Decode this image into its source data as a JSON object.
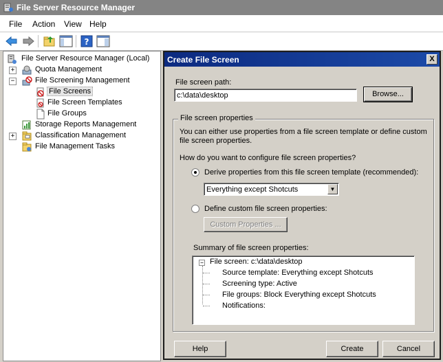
{
  "window": {
    "title": "File Server Resource Manager"
  },
  "menu": [
    "File",
    "Action",
    "View",
    "Help"
  ],
  "toolbar": {
    "icons": [
      "back-arrow-icon",
      "forward-arrow-icon",
      "up-folder-icon",
      "show-hide-tree-icon",
      "help-icon",
      "action-pane-icon"
    ]
  },
  "tree": {
    "root": "File Server Resource Manager (Local)",
    "items": [
      {
        "label": "Quota Management",
        "expander": "+"
      },
      {
        "label": "File Screening Management",
        "expander": "−"
      },
      {
        "label": "File Screens"
      },
      {
        "label": "File Screen Templates"
      },
      {
        "label": "File Groups"
      },
      {
        "label": "Storage Reports Management"
      },
      {
        "label": "Classification Management",
        "expander": "+"
      },
      {
        "label": "File Management Tasks"
      }
    ]
  },
  "dialog": {
    "title": "Create File Screen",
    "close": "X",
    "path_label": "File screen path:",
    "path_value": "c:\\data\\desktop",
    "browse": "Browse...",
    "group_title": "File screen properties",
    "desc_line1": "You can either use properties from a file screen template or define custom",
    "desc_line2": "file screen properties.",
    "question": "How do you want to configure file screen properties?",
    "radio_derive": "Derive properties from this file screen template (recommended):",
    "template_value": "Everything except Shotcuts",
    "radio_custom": "Define custom file screen properties:",
    "custom_button": "Custom Properties ...",
    "summary_label": "Summary of file screen properties:",
    "summary": {
      "root": "File screen: c:\\data\\desktop",
      "lines": [
        "Source template: Everything except Shotcuts",
        "Screening type: Active",
        "File groups: Block Everything except Shotcuts",
        "Notifications:"
      ]
    },
    "help": "Help",
    "create": "Create",
    "cancel": "Cancel"
  }
}
